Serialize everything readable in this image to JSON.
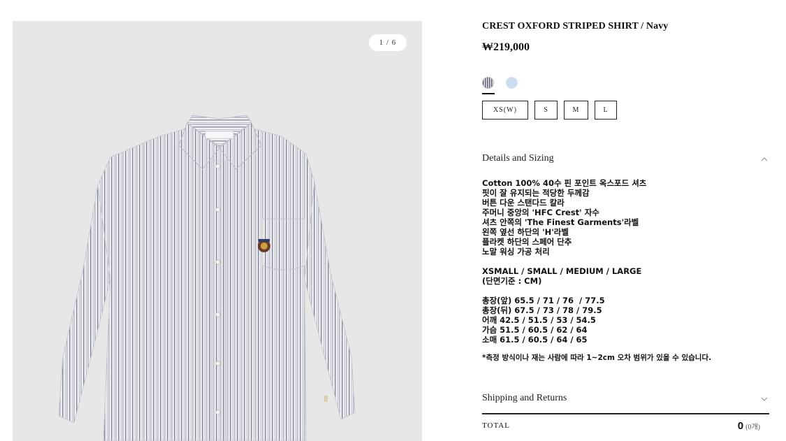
{
  "gallery": {
    "counter": "1 / 6",
    "image_alt": "Crest Oxford Striped Shirt"
  },
  "product": {
    "title": "CREST OXFORD STRIPED SHIRT / Navy",
    "price": "₩219,000",
    "colors": [
      {
        "name": "Navy stripe",
        "hex": "#5c5f73",
        "selected": true
      },
      {
        "name": "Light blue",
        "hex": "#ccdcef",
        "selected": false
      }
    ],
    "sizes": [
      "XS(W)",
      "S",
      "M",
      "L"
    ]
  },
  "details": {
    "heading": "Details and Sizing",
    "features": [
      "Cotton 100% 40수 핀 포인트 옥스포드 셔츠",
      "핏이 잘 유지되는 적당한 두께감",
      "버튼 다운 스탠다드 칼라",
      "주머니 중앙의 'HFC Crest' 자수",
      "셔츠 안쪽의 'The Finest Garments'라벨",
      "왼쪽 옆선 하단의 'H'라벨",
      "플라켓 하단의 스페어 단추",
      "노말 워싱 가공 처리"
    ],
    "size_header": "XSMALL / SMALL / MEDIUM / LARGE",
    "unit_note": "(단면기준 : CM)",
    "measurements": [
      "총장(앞) 65.5 / 71 / 76  / 77.5",
      "총장(뒤) 67.5 / 73 / 78 / 79.5",
      "어깨 42.5 / 51.5 / 53 / 54.5",
      "가슴 51.5 / 60.5 / 62 / 64",
      "소매 61.5 / 60.5 / 64 / 65"
    ],
    "disclaimer": "*측정 방식이나 재는 사람에 따라 1~2cm 오차 범위가 있을 수 있습니다."
  },
  "shipping": {
    "heading": "Shipping and Returns"
  },
  "total": {
    "label": "TOTAL",
    "value": "0",
    "count": "(0개)"
  },
  "colors": {
    "background_image": "#e7e7e8",
    "shirt_base": "#f1f1f3",
    "stripe": "#8f93a3",
    "text": "#111111"
  }
}
